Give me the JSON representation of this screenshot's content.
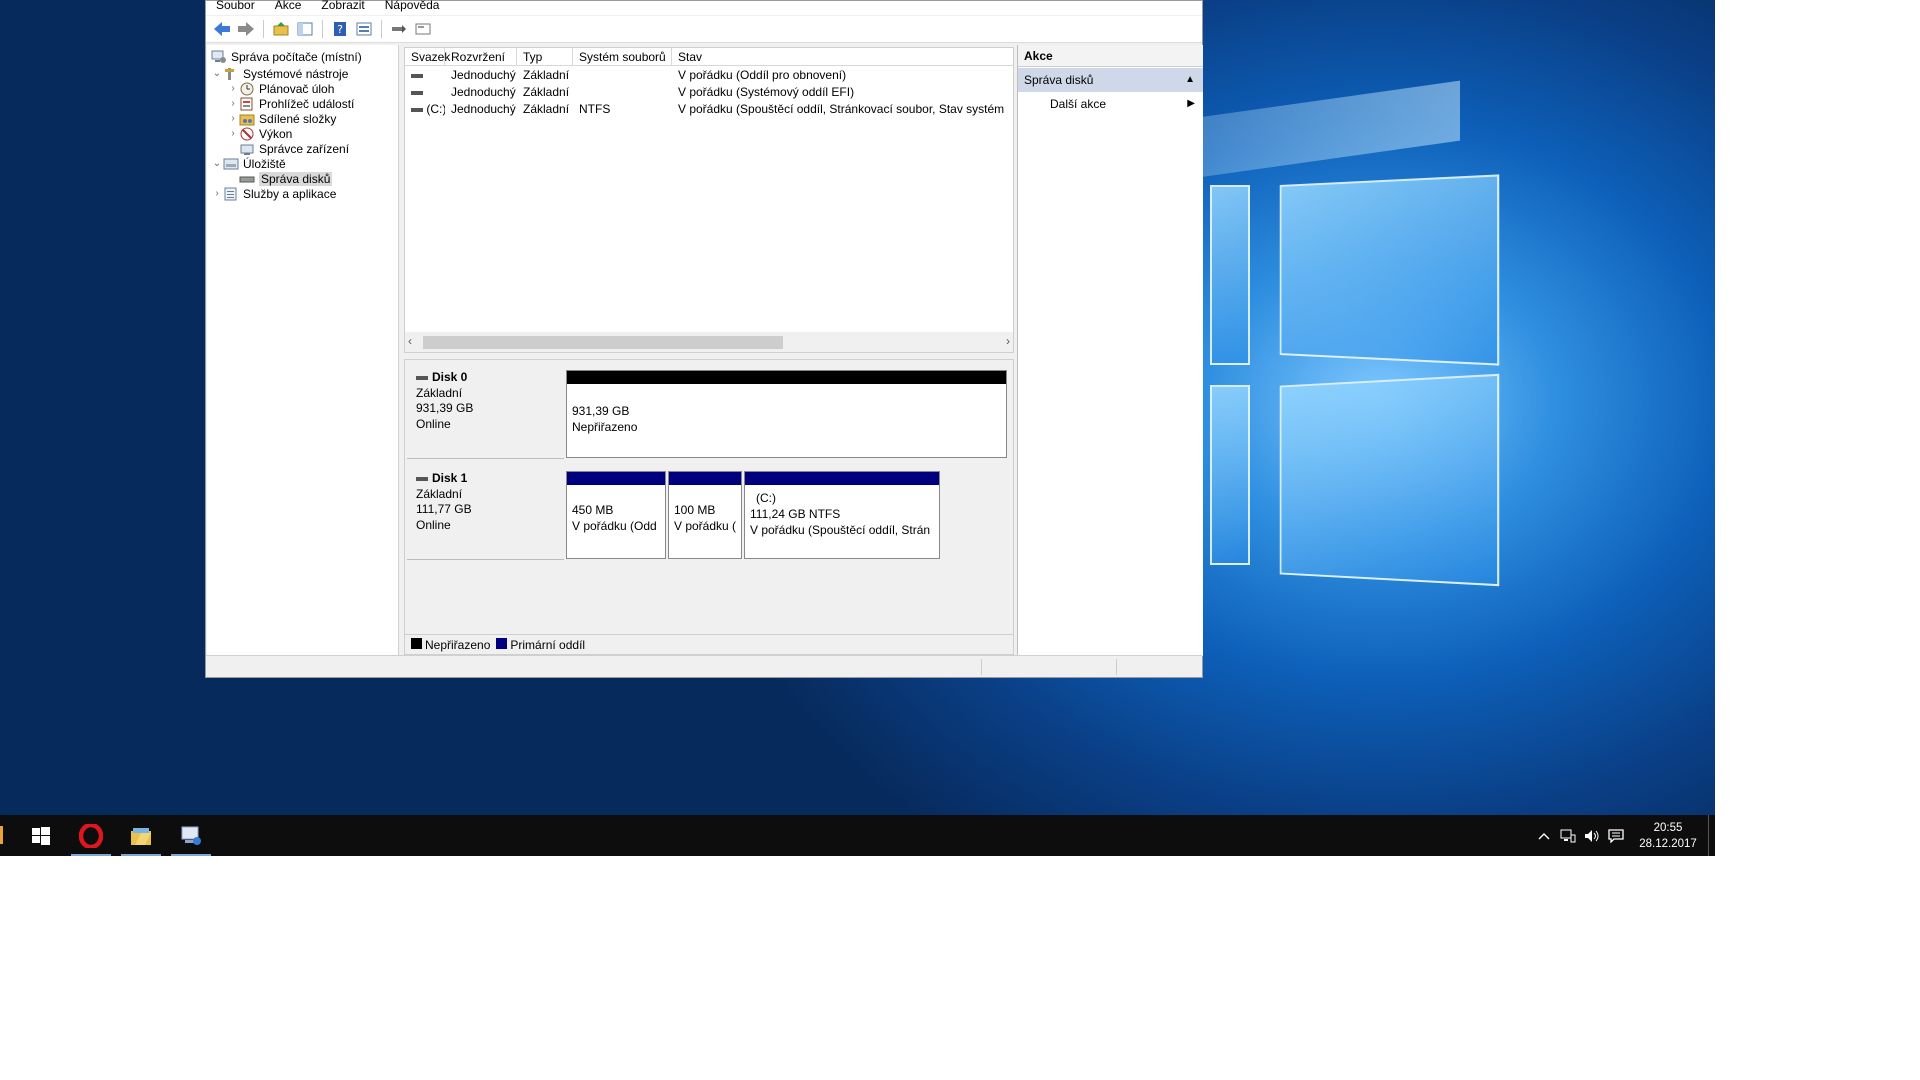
{
  "menu": [
    "Soubor",
    "Akce",
    "Zobrazit",
    "Nápověda"
  ],
  "tree": {
    "root": "Správa počítače (místní)",
    "system_tools": "Systémové nástroje",
    "task_scheduler": "Plánovač úloh",
    "event_viewer": "Prohlížeč událostí",
    "shared_folders": "Sdílené složky",
    "performance": "Výkon",
    "device_manager": "Správce zařízení",
    "storage": "Úložiště",
    "disk_management": "Správa disků",
    "services": "Služby a aplikace"
  },
  "volumes": {
    "columns": [
      "Svazek",
      "Rozvržení",
      "Typ",
      "Systém souborů",
      "Stav"
    ],
    "rows": [
      {
        "volume": "",
        "layout": "Jednoduchý",
        "type": "Základní",
        "fs": "",
        "status": "V pořádku (Oddíl pro obnovení)"
      },
      {
        "volume": "",
        "layout": "Jednoduchý",
        "type": "Základní",
        "fs": "",
        "status": "V pořádku (Systémový oddíl EFI)"
      },
      {
        "volume": "(C:)",
        "layout": "Jednoduchý",
        "type": "Základní",
        "fs": "NTFS",
        "status": "V pořádku (Spouštěcí oddíl, Stránkovací soubor, Stav systém"
      }
    ]
  },
  "disks": {
    "disk0": {
      "name": "Disk 0",
      "type": "Základní",
      "size": "931,39 GB",
      "state": "Online",
      "partition": {
        "size": "931,39 GB",
        "status": "Nepřiřazeno"
      }
    },
    "disk1": {
      "name": "Disk 1",
      "type": "Základní",
      "size": "111,77 GB",
      "state": "Online",
      "p1": {
        "size": "450 MB",
        "status": "V pořádku (Odd"
      },
      "p2": {
        "size": "100 MB",
        "status": "V pořádku ("
      },
      "p3": {
        "label": "(C:)",
        "size": "111,24 GB NTFS",
        "status": "V pořádku (Spouštěcí oddíl, Strán"
      }
    }
  },
  "legend": {
    "unallocated": "Nepřiřazeno",
    "primary": "Primární oddíl"
  },
  "actions": {
    "title": "Akce",
    "section": "Správa disků",
    "more": "Další akce"
  },
  "taskbar": {
    "time": "20:55",
    "date": "28.12.2017"
  },
  "colors": {
    "unallocated": "#000000",
    "primary": "#00007f",
    "taskbar": "#0d0d0d"
  }
}
